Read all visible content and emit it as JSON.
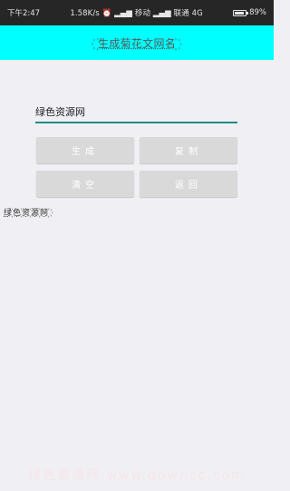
{
  "status_bar": {
    "time": "下午2:47",
    "network_speed": "1.58K/s",
    "carrier1": "移动",
    "carrier2": "联通 4G",
    "battery": "89%",
    "battery_level": 0.89
  },
  "app": {
    "title": "꙰生成菊花文网名꙰"
  },
  "input": {
    "value": "绿色资源网"
  },
  "buttons": {
    "generate": "生成",
    "copy": "复制",
    "clear": "清空",
    "back": "返回"
  },
  "result": {
    "text": "绿꙰色꙰资꙰源꙰网꙰"
  },
  "watermark": {
    "text": "绿色资源网 www.downcc.com"
  },
  "colors": {
    "title_bar": "#00ffff",
    "status_bar": "#262626",
    "accent_underline": "#1e8c86",
    "button_bg": "#d9d9d9",
    "page_bg": "#f0eff3"
  }
}
